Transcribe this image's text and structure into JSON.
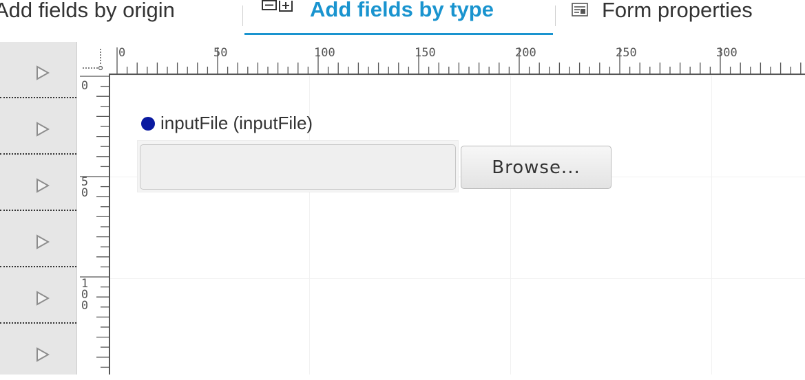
{
  "tabs": [
    {
      "label": "Add fields by origin",
      "icon": "origin-icon"
    },
    {
      "label": "Add fields by type",
      "icon": "add-field-icon",
      "active": true
    },
    {
      "label": "Form properties",
      "icon": "form-properties-icon"
    }
  ],
  "colors": {
    "accent": "#1a94cf",
    "required_dot": "#0a1aa0"
  },
  "ruler": {
    "top_labels": [
      "0",
      "50",
      "100",
      "150",
      "200",
      "250",
      "300"
    ],
    "left_labels": [
      "0",
      "50",
      "100"
    ]
  },
  "row_handles": 6,
  "field": {
    "label": "inputFile (inputFile)",
    "input_value": "",
    "browse_label": "Browse..."
  }
}
